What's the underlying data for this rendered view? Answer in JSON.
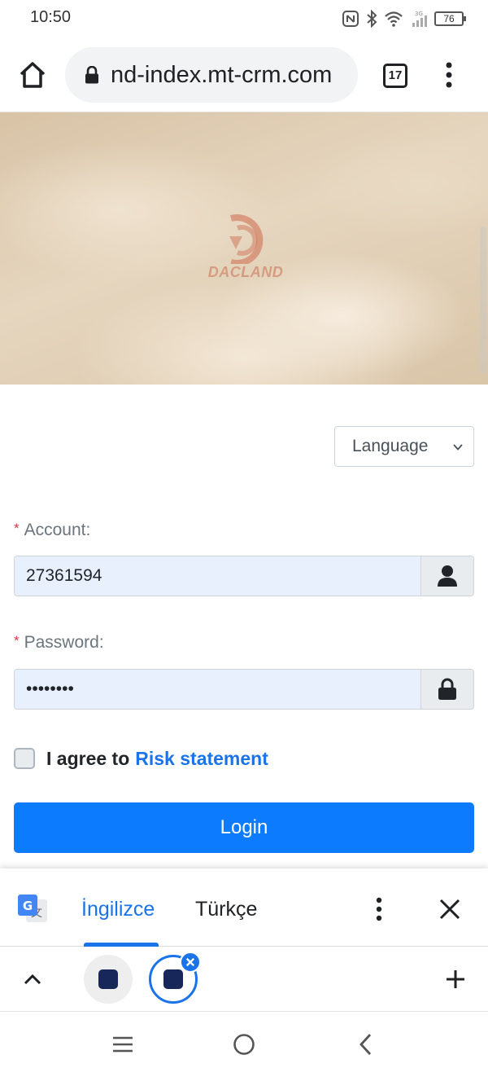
{
  "status_bar": {
    "time": "10:50",
    "battery": "76",
    "network": "3G"
  },
  "browser": {
    "url": "nd-index.mt-crm.com",
    "tab_count": "17"
  },
  "hero": {
    "logo_text": "DACLAND"
  },
  "language_select": {
    "selected": "Language"
  },
  "form": {
    "required_marker": "*",
    "account_label": "Account:",
    "account_value": "27361594",
    "password_label": "Password:",
    "password_value": "password",
    "agree_text": "I agree to",
    "risk_link": "Risk statement",
    "login_label": "Login"
  },
  "translate_bar": {
    "source_language": "İngilizce",
    "target_language": "Türkçe"
  },
  "colors": {
    "primary": "#0d7bfd",
    "link": "#1a73e8",
    "required": "#dc3545"
  }
}
